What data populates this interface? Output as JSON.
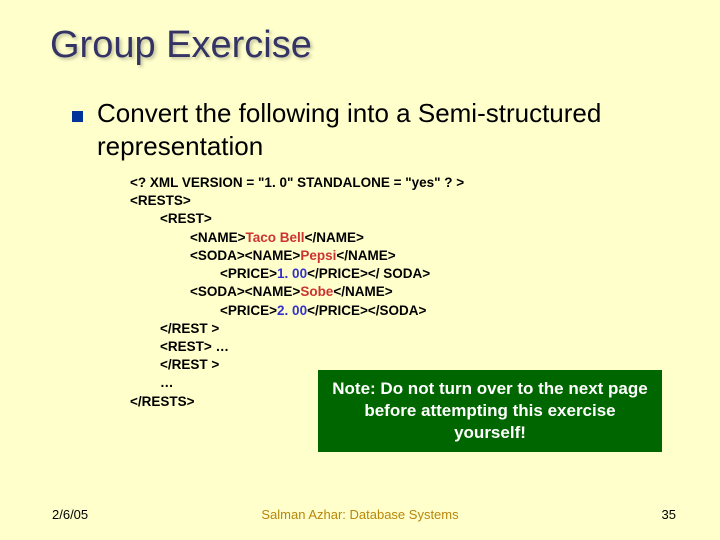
{
  "title": "Group Exercise",
  "body": "Convert the following into a Semi-structured representation",
  "code": {
    "l1a": "<? XML VERSION = \"1. 0\" STANDALONE = \"yes\" ? >",
    "l2a": "<RESTS>",
    "l3a": "        <REST>",
    "l4a": "                <NAME>",
    "l4b": "Taco Bell",
    "l4c": "</NAME>",
    "l5a": "                <SODA><NAME>",
    "l5b": "Pepsi",
    "l5c": "</NAME>",
    "l6a": "                        <PRICE>",
    "l6b": "1. 00",
    "l6c": "</PRICE></ SODA>",
    "l7a": "                <SODA><NAME>",
    "l7b": "Sobe",
    "l7c": "</NAME>",
    "l8a": "                        <PRICE>",
    "l8b": "2. 00",
    "l8c": "</PRICE></SODA>",
    "l9a": "        </REST >",
    "l10a": "        <REST> …",
    "l11a": "        </REST >",
    "l12a": "        …",
    "l13a": "</RESTS>"
  },
  "note": "Note: Do not turn over to the next page before attempting this exercise yourself!",
  "footer": {
    "date": "2/6/05",
    "center": "Salman Azhar: Database Systems",
    "page": "35"
  }
}
